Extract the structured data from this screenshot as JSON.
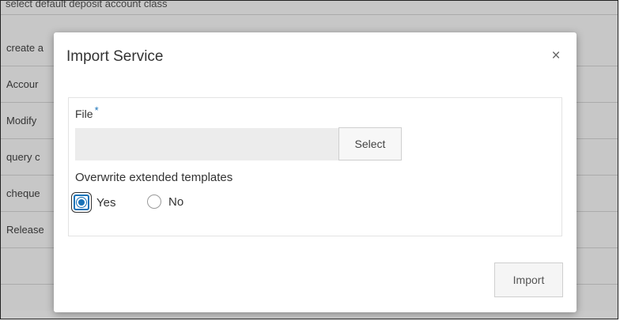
{
  "background": {
    "top_text": "select default deposit account class",
    "rows": [
      {
        "label": "create a"
      },
      {
        "label": "Accour"
      },
      {
        "label": "Modify"
      },
      {
        "label": "query c"
      },
      {
        "label": "cheque"
      },
      {
        "label": "Release"
      },
      {
        "label": ""
      }
    ]
  },
  "dialog": {
    "title": "Import Service",
    "close_icon": "close-icon",
    "close_glyph": "×",
    "file_label": "File",
    "required_marker": "*",
    "select_button": "Select",
    "overwrite_label": "Overwrite extended templates",
    "options": [
      {
        "label": "Yes",
        "selected": true
      },
      {
        "label": "No",
        "selected": false
      }
    ],
    "import_button": "Import",
    "accent_color": "#1a73b8"
  }
}
